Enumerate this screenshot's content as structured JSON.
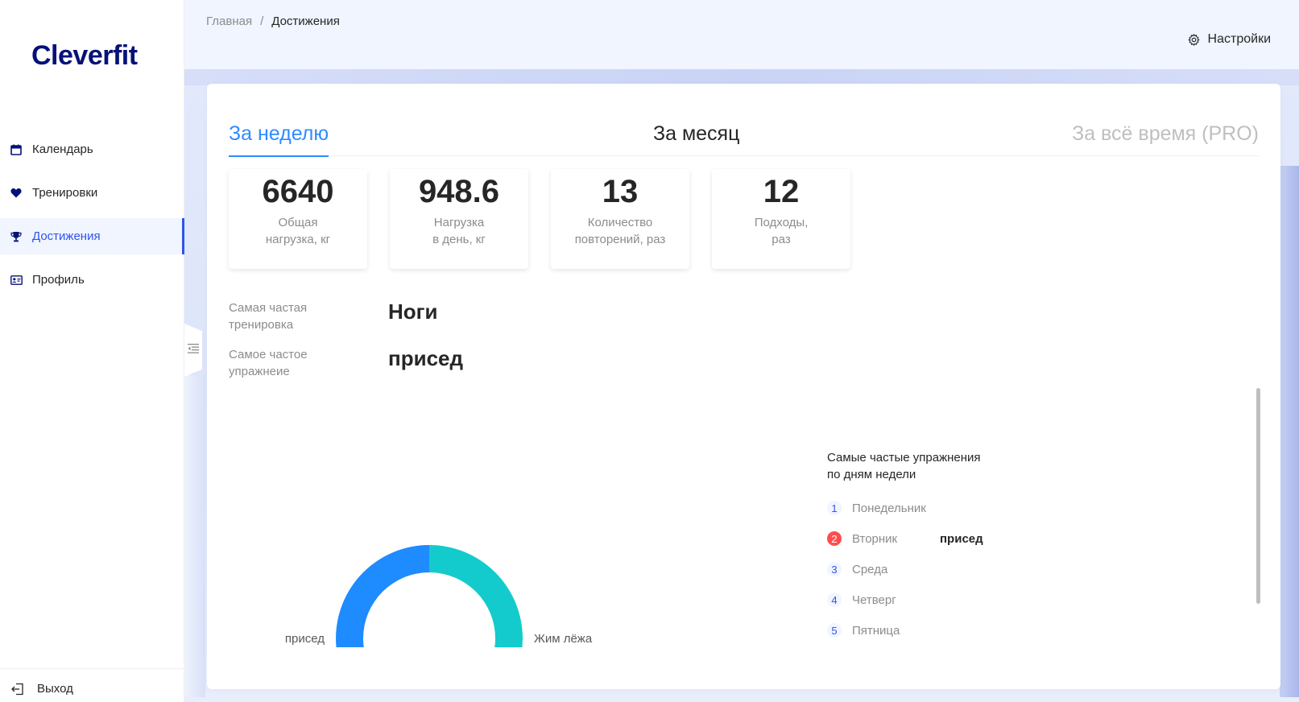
{
  "sidebar": {
    "logo": "Cleverfit",
    "items": [
      {
        "label": "Календарь",
        "icon": "calendar-icon"
      },
      {
        "label": "Тренировки",
        "icon": "heart-icon"
      },
      {
        "label": "Достижения",
        "icon": "trophy-icon",
        "active": true
      },
      {
        "label": "Профиль",
        "icon": "idcard-icon"
      }
    ],
    "logout_label": "Выход"
  },
  "header": {
    "breadcrumb": [
      "Главная",
      "Достижения"
    ],
    "settings_label": "Настройки"
  },
  "tabs": [
    {
      "label": "За неделю",
      "active": true
    },
    {
      "label": "За месяц"
    },
    {
      "label": "За всё время (PRO)",
      "disabled": true
    }
  ],
  "stats": [
    {
      "value": "6640",
      "label": "Общая\nнагрузка, кг"
    },
    {
      "value": "948.6",
      "label": "Нагрузка\nв день, кг"
    },
    {
      "value": "13",
      "label": "Количество\nповторений, раз"
    },
    {
      "value": "12",
      "label": "Подходы,\nраз"
    }
  ],
  "frequent": {
    "training_label": "Самая частая\nтренировка",
    "training_value": "Ноги",
    "exercise_label": "Самое частое\nупражнеие",
    "exercise_value": "присед"
  },
  "chart_data": {
    "type": "pie",
    "categories": [
      "присед",
      "Жим лёжа"
    ],
    "values": [
      50,
      50
    ],
    "colors": [
      "#1e8bff",
      "#13cbcc"
    ],
    "title": "",
    "donut": true
  },
  "weekdays": {
    "title": "Самые частые упражнения\nпо дням недели",
    "items": [
      {
        "num": "1",
        "day": "Понедельник",
        "exercise": "",
        "alert": false
      },
      {
        "num": "2",
        "day": "Вторник",
        "exercise": "присед",
        "alert": true
      },
      {
        "num": "3",
        "day": "Среда",
        "exercise": "",
        "alert": false
      },
      {
        "num": "4",
        "day": "Четверг",
        "exercise": "",
        "alert": false
      },
      {
        "num": "5",
        "day": "Пятница",
        "exercise": "",
        "alert": false
      }
    ]
  }
}
